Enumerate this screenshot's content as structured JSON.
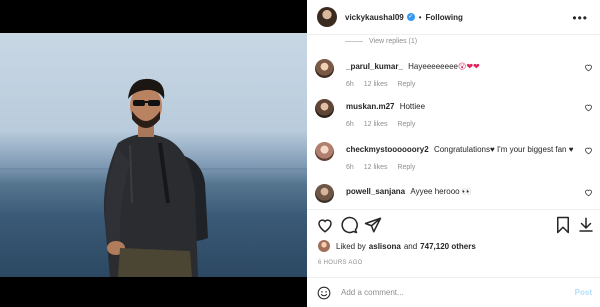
{
  "header": {
    "username": "vickykaushal09",
    "verified_badge": "✓",
    "separator": "•",
    "follow_label": "Following",
    "more_label": "•••"
  },
  "view_replies": "View replies (1)",
  "comments": [
    {
      "username": "_parul_kumar_",
      "text": "Hayeeeeeeee",
      "emoji": "😮❤❤",
      "time": "6h",
      "likes": "12 likes",
      "reply": "Reply"
    },
    {
      "username": "muskan.m27",
      "text": "Hottiee",
      "emoji": "",
      "time": "6h",
      "likes": "12 likes",
      "reply": "Reply"
    },
    {
      "username": "checkmystoooooory2",
      "text": "Congratulations♥ I'm your biggest fan ♥",
      "emoji": "",
      "time": "6h",
      "likes": "12 likes",
      "reply": "Reply"
    },
    {
      "username": "powell_sanjana",
      "text": "Ayyee herooo",
      "emoji": "👀",
      "time": "",
      "likes": "",
      "reply": ""
    }
  ],
  "liked_by": {
    "prefix": "Liked by ",
    "user": "aslisona",
    "middle": " and ",
    "count": "747,120 others"
  },
  "time_ago": "6 HOURS AGO",
  "add_comment": {
    "placeholder": "Add a comment...",
    "post_label": "Post"
  },
  "icons": [
    "heart-icon",
    "comment-icon",
    "share-icon",
    "bookmark-icon",
    "download-icon",
    "emoji-icon"
  ],
  "colors": {
    "verified": "#3897f0",
    "post_disabled": "#b2dffc",
    "muted": "#8e8e8e"
  }
}
